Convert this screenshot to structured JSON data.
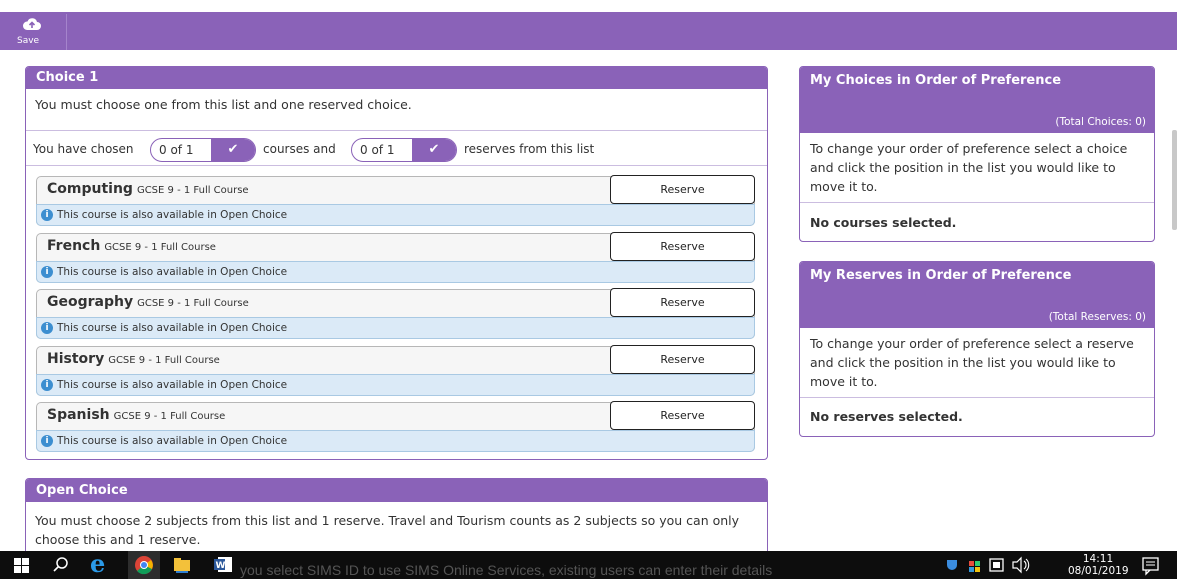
{
  "toolbar": {
    "save_label": "Save"
  },
  "choice1": {
    "title": "Choice 1",
    "instruction": "You must choose one from this list and one reserved choice.",
    "chosen_prefix": "You have chosen",
    "courses_count": "0 of 1",
    "courses_mid": "courses and",
    "reserves_count": "0 of 1",
    "reserves_suffix": "reserves from this list",
    "courses": [
      {
        "name": "Computing",
        "subtitle": "GCSE 9 - 1 Full Course",
        "reserve_label": "Reserve",
        "info": "This course is also available in Open Choice"
      },
      {
        "name": "French",
        "subtitle": "GCSE 9 - 1 Full Course",
        "reserve_label": "Reserve",
        "info": "This course is also available in Open Choice"
      },
      {
        "name": "Geography",
        "subtitle": "GCSE 9 - 1 Full Course",
        "reserve_label": "Reserve",
        "info": "This course is also available in Open Choice"
      },
      {
        "name": "History",
        "subtitle": "GCSE 9 - 1 Full Course",
        "reserve_label": "Reserve",
        "info": "This course is also available in Open Choice"
      },
      {
        "name": "Spanish",
        "subtitle": "GCSE 9 - 1 Full Course",
        "reserve_label": "Reserve",
        "info": "This course is also available in Open Choice"
      }
    ]
  },
  "open_choice": {
    "title": "Open Choice",
    "description": "You must choose 2 subjects from this list and 1 reserve. Travel and Tourism counts as 2 subjects so you can only choose this and 1 reserve."
  },
  "my_choices": {
    "title": "My Choices in Order of Preference",
    "total": "(Total Choices: 0)",
    "help": "To change your order of preference select a choice and click the position in the list you would like to move it to.",
    "empty": "No courses selected."
  },
  "my_reserves": {
    "title": "My Reserves in Order of Preference",
    "total": "(Total Reserves: 0)",
    "help": "To change your order of preference select a reserve and click the position in the list you would like to move it to.",
    "empty": "No reserves selected."
  },
  "obscured_text": "you select SIMS ID to use SIMS Online Services, existing users can enter their details",
  "taskbar": {
    "time": "14:11",
    "date": "08/01/2019",
    "icons": [
      "windows-logo-icon",
      "search-icon",
      "internet-explorer-icon",
      "chrome-icon",
      "file-explorer-icon",
      "word-icon"
    ]
  },
  "colors": {
    "accent": "#8a62b8",
    "info_bg": "#dbeaf7",
    "info_icon": "#3c8ed0"
  }
}
